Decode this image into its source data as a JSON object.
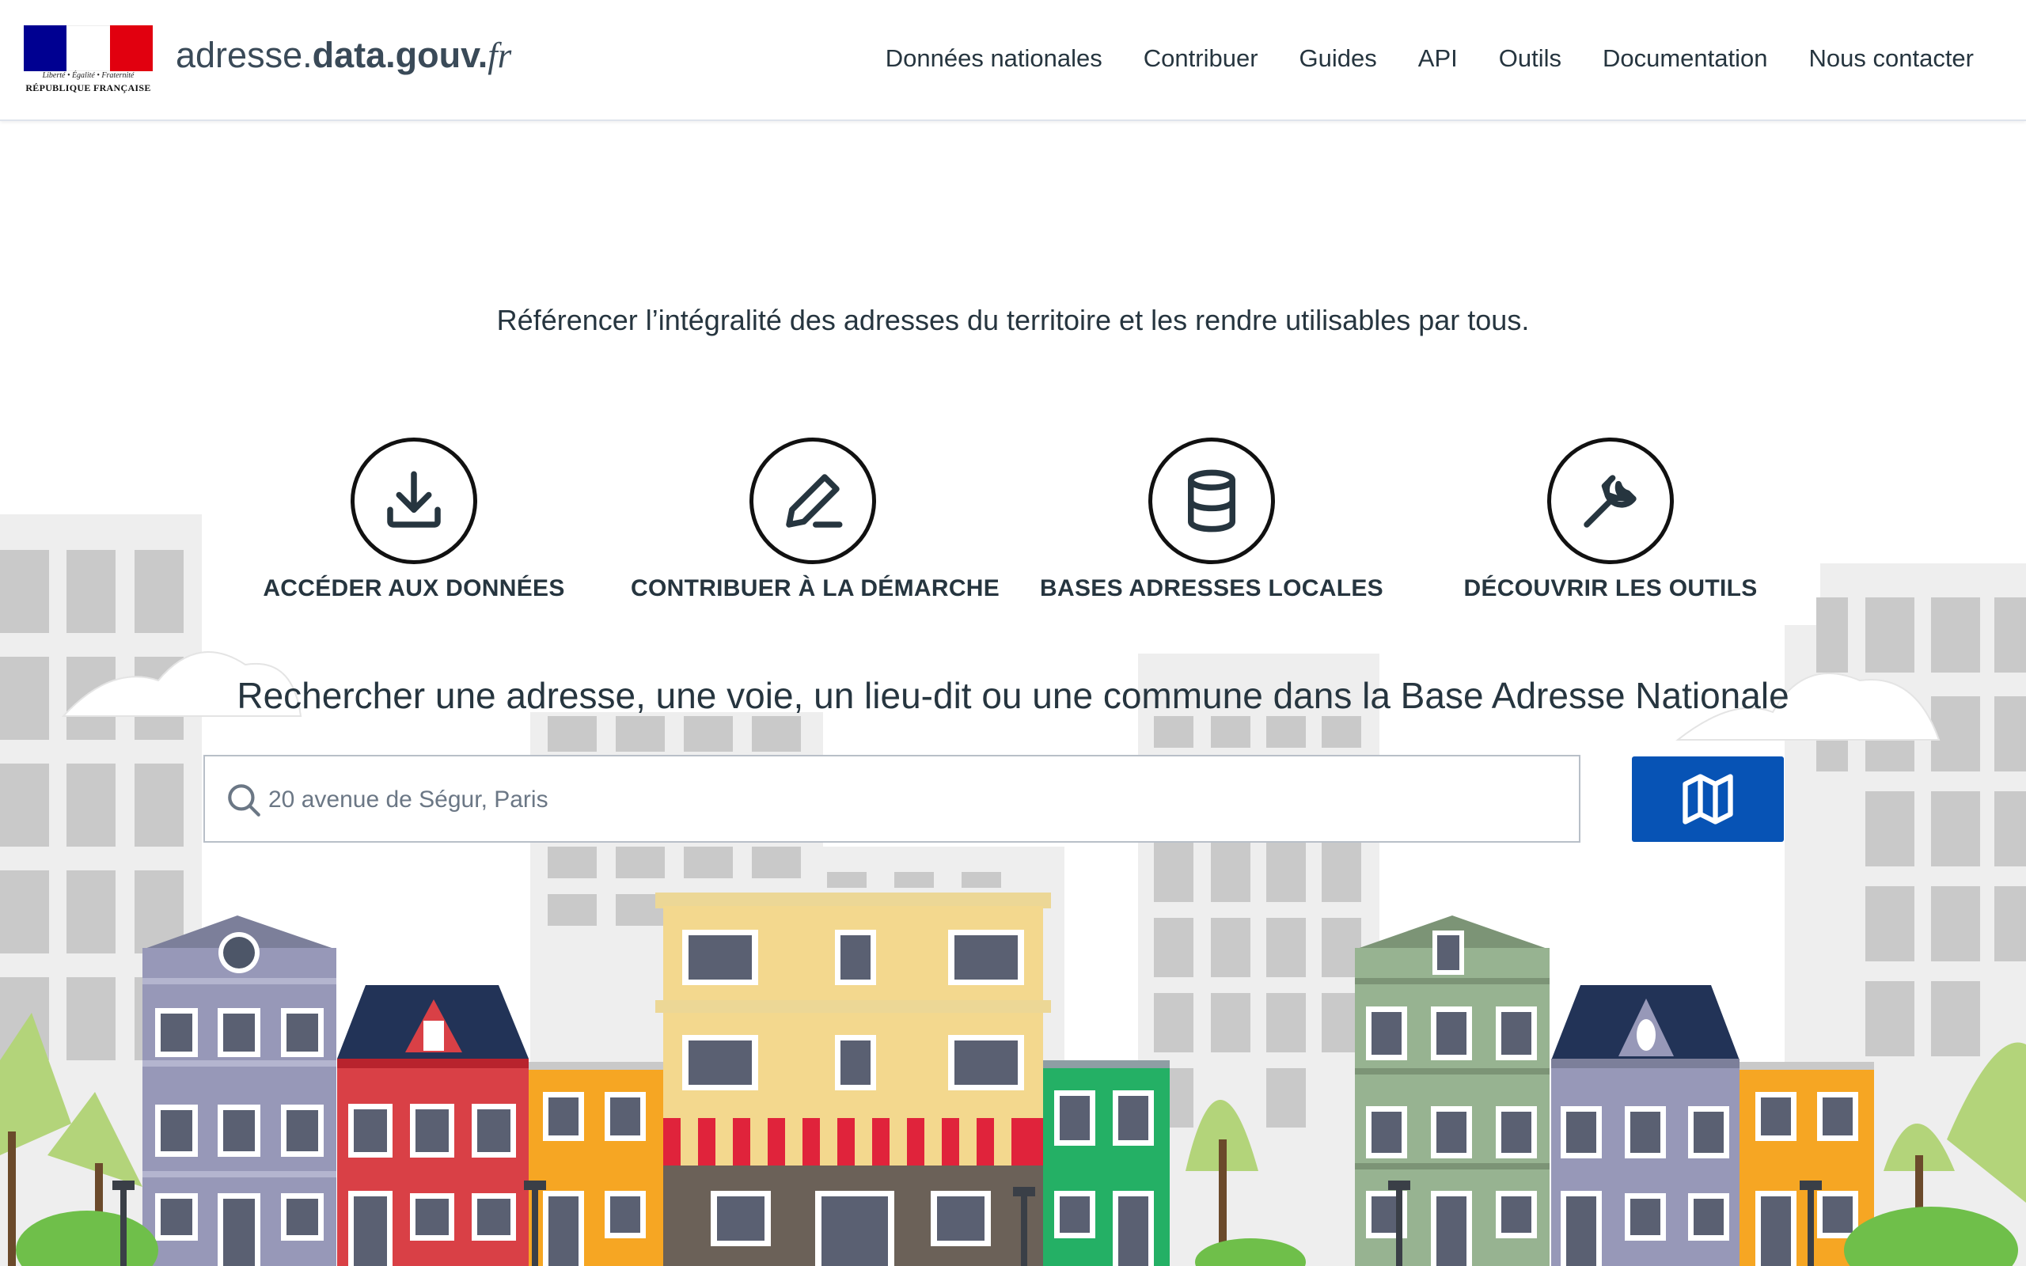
{
  "header": {
    "logo": {
      "motto": "Liberté • Égalité • Fraternité",
      "republique": "RÉPUBLIQUE FRANÇAISE",
      "flag_colors": [
        "#000091",
        "#ffffff",
        "#e1000f"
      ]
    },
    "brand": {
      "part1": "adresse.",
      "part2": "data.gouv.",
      "part3": "fr"
    },
    "nav": [
      "Données nationales",
      "Contribuer",
      "Guides",
      "API",
      "Outils",
      "Documentation",
      "Nous contacter"
    ]
  },
  "hero": {
    "tagline": "Référencer l’intégralité des adresses du territoire et les rendre utilisables par tous."
  },
  "features": [
    {
      "icon": "download-icon",
      "label": "ACCÉDER AUX DONNÉES"
    },
    {
      "icon": "pencil-icon",
      "label": "CONTRIBUER À LA DÉMARCHE"
    },
    {
      "icon": "database-icon",
      "label": "BASES ADRESSES LOCALES"
    },
    {
      "icon": "wrench-icon",
      "label": "DÉCOUVRIR LES OUTILS"
    }
  ],
  "search": {
    "title": "Rechercher une adresse, une voie, un lieu-dit ou une commune dans la Base Adresse Nationale",
    "placeholder": "20 avenue de Ségur, Paris",
    "value": "",
    "map_button_icon": "map-icon"
  },
  "colors": {
    "primary_button": "#0753b5",
    "text": "#26353f"
  }
}
